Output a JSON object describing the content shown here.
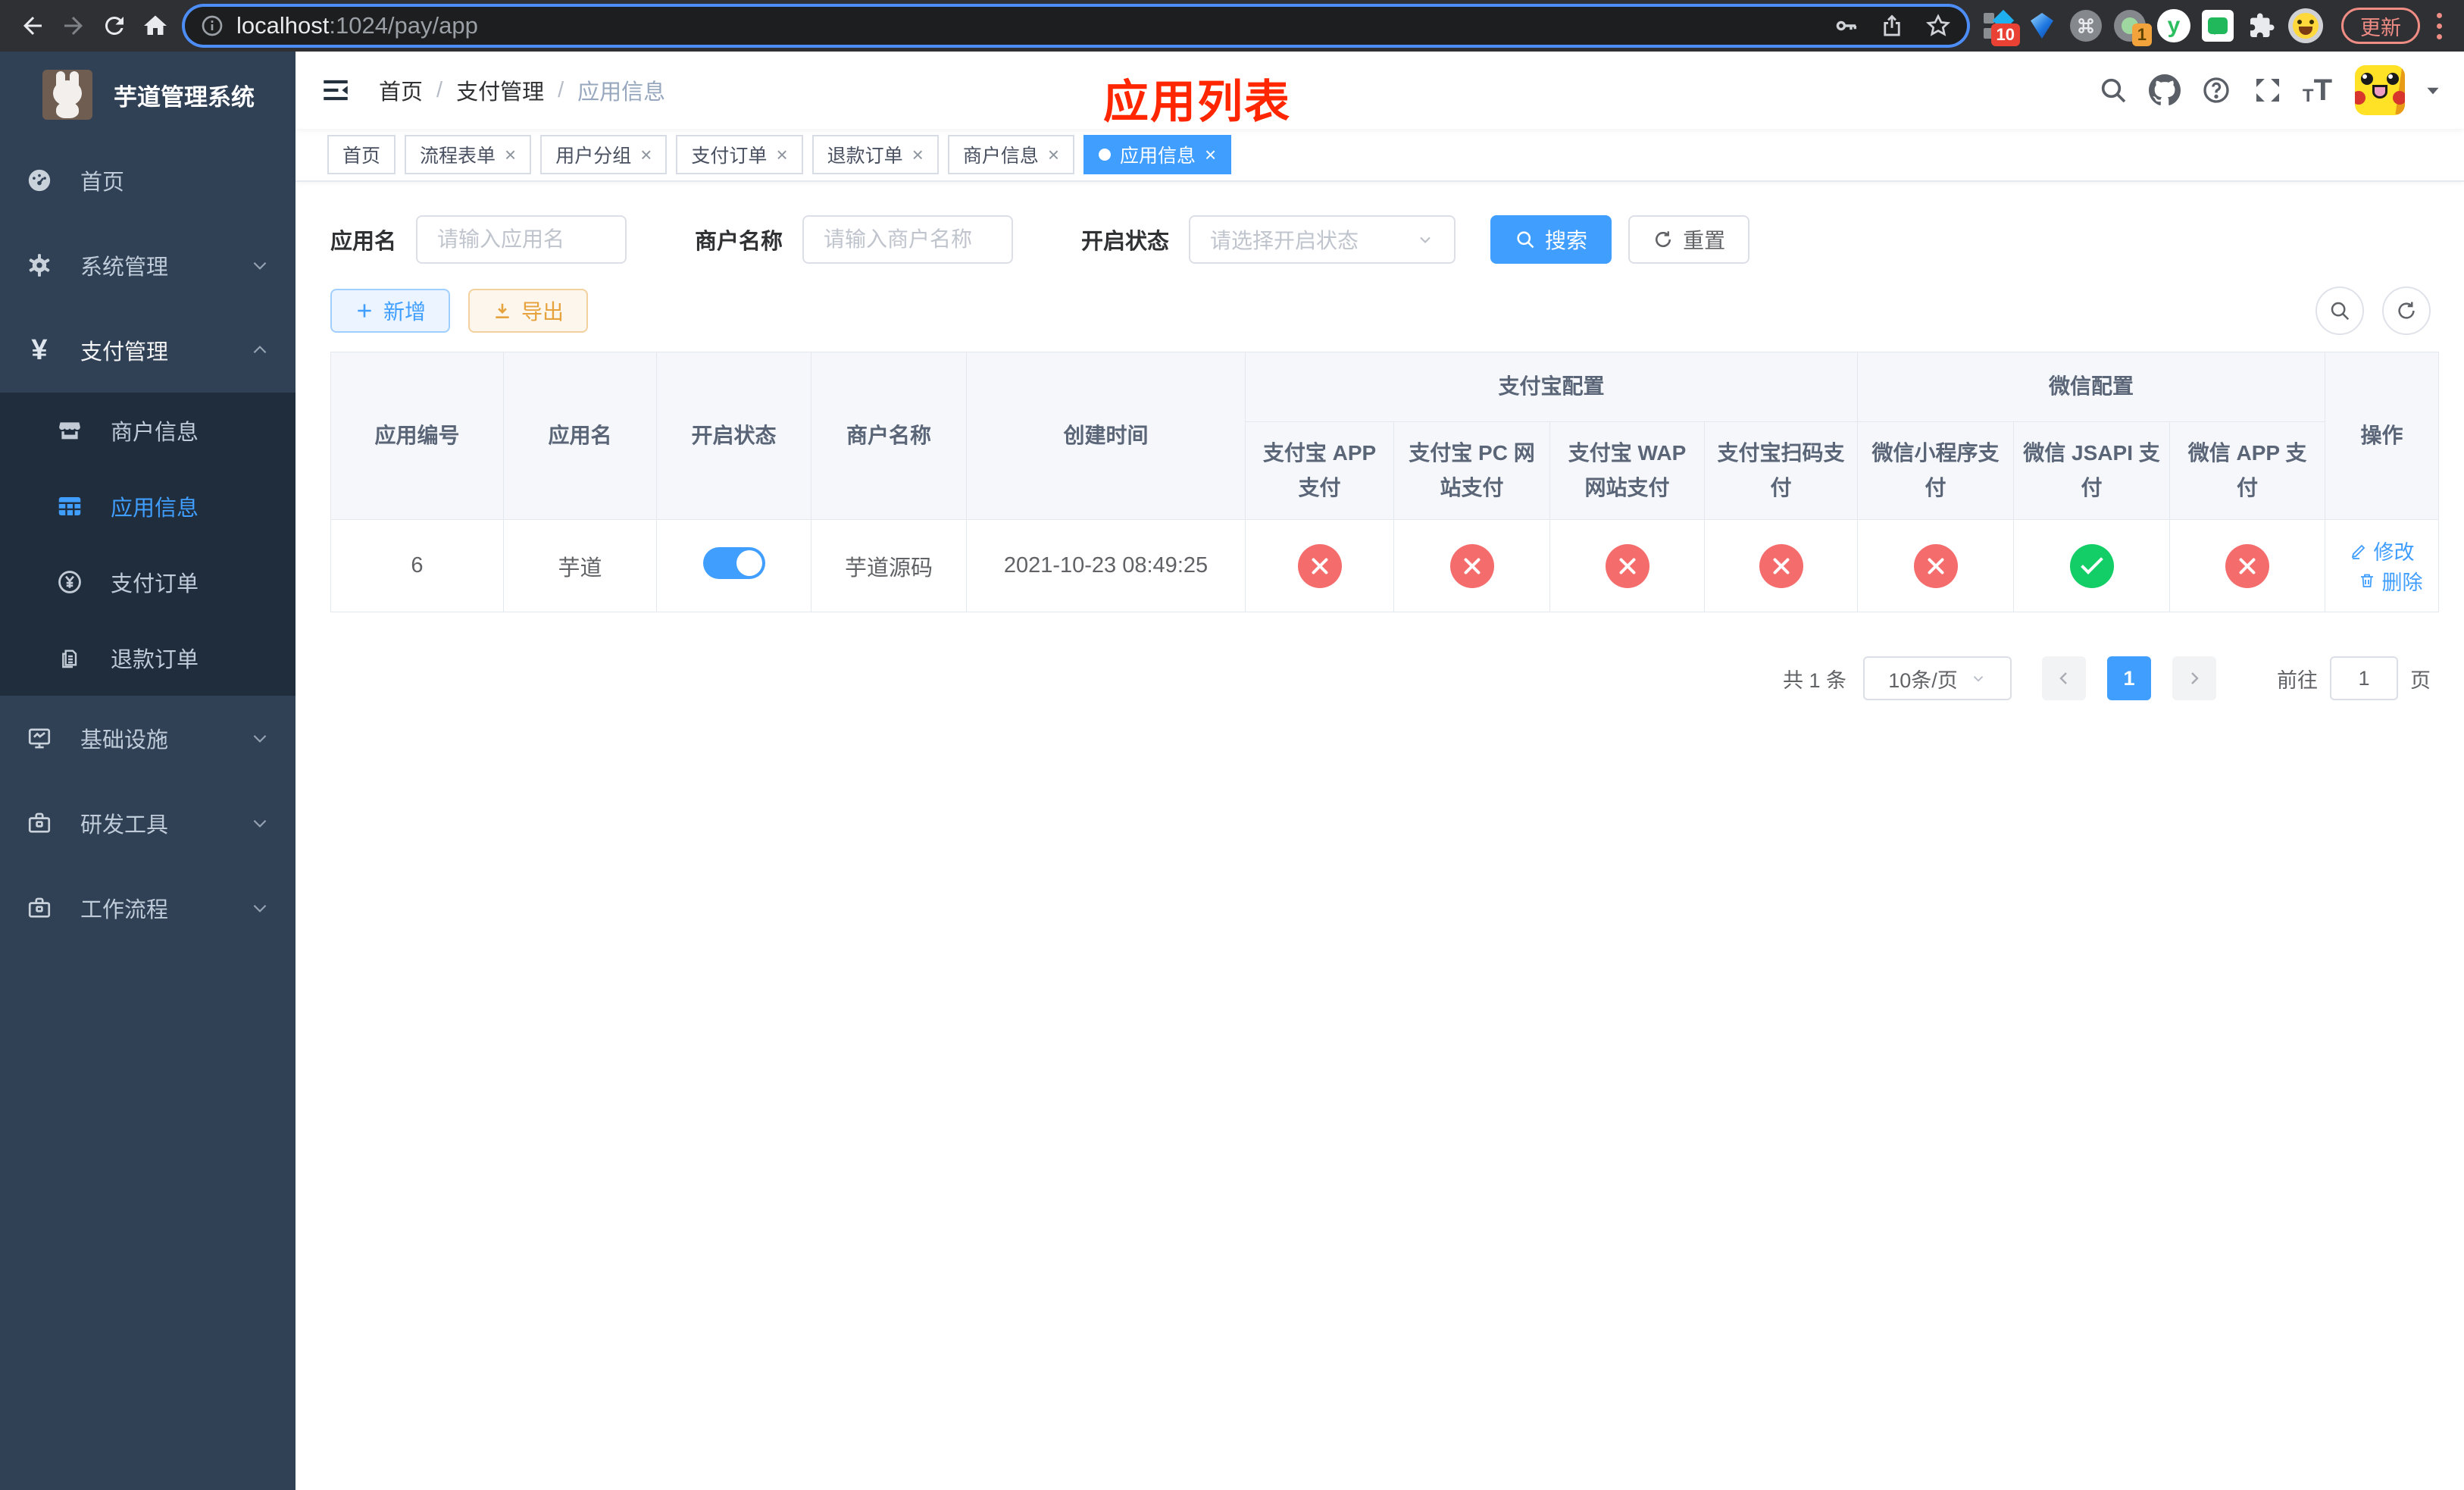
{
  "colors": {
    "accent": "#409eff",
    "danger": "#f56c6c",
    "success": "#13ce66",
    "warning": "#e6a23c",
    "overlay_title_red": "#ff2600"
  },
  "browser": {
    "url_host": "localhost",
    "url_path": ":1024/pay/app",
    "ext_badge_blue": "10",
    "ext_badge_green": "1",
    "update_label": "更新"
  },
  "sidebar": {
    "title": "芋道管理系统",
    "menu": [
      {
        "label": "首页"
      },
      {
        "label": "系统管理"
      },
      {
        "label": "支付管理"
      },
      {
        "label": "基础设施"
      },
      {
        "label": "研发工具"
      },
      {
        "label": "工作流程"
      }
    ],
    "submenu": [
      {
        "label": "商户信息"
      },
      {
        "label": "应用信息"
      },
      {
        "label": "支付订单"
      },
      {
        "label": "退款订单"
      }
    ]
  },
  "navbar": {
    "breadcrumb": [
      "首页",
      "支付管理",
      "应用信息"
    ],
    "overlay_title": "应用列表"
  },
  "tabs": [
    {
      "label": "首页"
    },
    {
      "label": "流程表单"
    },
    {
      "label": "用户分组"
    },
    {
      "label": "支付订单"
    },
    {
      "label": "退款订单"
    },
    {
      "label": "商户信息"
    },
    {
      "label": "应用信息"
    }
  ],
  "filters": {
    "app_name_label": "应用名",
    "app_name_placeholder": "请输入应用名",
    "merchant_label": "商户名称",
    "merchant_placeholder": "请输入商户名称",
    "status_label": "开启状态",
    "status_placeholder": "请选择开启状态",
    "search_label": "搜索",
    "reset_label": "重置"
  },
  "toolbar": {
    "add_label": "新增",
    "export_label": "导出"
  },
  "table": {
    "columns": {
      "id": "应用编号",
      "name": "应用名",
      "enabled": "开启状态",
      "merchant": "商户名称",
      "created": "创建时间",
      "op": "操作"
    },
    "groups": {
      "alipay": {
        "label": "支付宝配置",
        "columns": [
          "支付宝 APP 支付",
          "支付宝 PC 网站支付",
          "支付宝 WAP 网站支付",
          "支付宝扫码支付"
        ]
      },
      "wechat": {
        "label": "微信配置",
        "columns": [
          "微信小程序支付",
          "微信 JSAPI 支付",
          "微信 APP 支付"
        ]
      }
    },
    "row": {
      "id": "6",
      "name": "芋道",
      "enabled": true,
      "merchant": "芋道源码",
      "created": "2021-10-23 08:49:25",
      "statuses": [
        false,
        false,
        false,
        false,
        false,
        true,
        false
      ],
      "edit_label": "修改",
      "delete_label": "删除"
    }
  },
  "pagination": {
    "total": "共 1 条",
    "page_size": "10条/页",
    "page": "1",
    "goto_label": "前往",
    "goto_value": "1",
    "unit_label": "页"
  }
}
